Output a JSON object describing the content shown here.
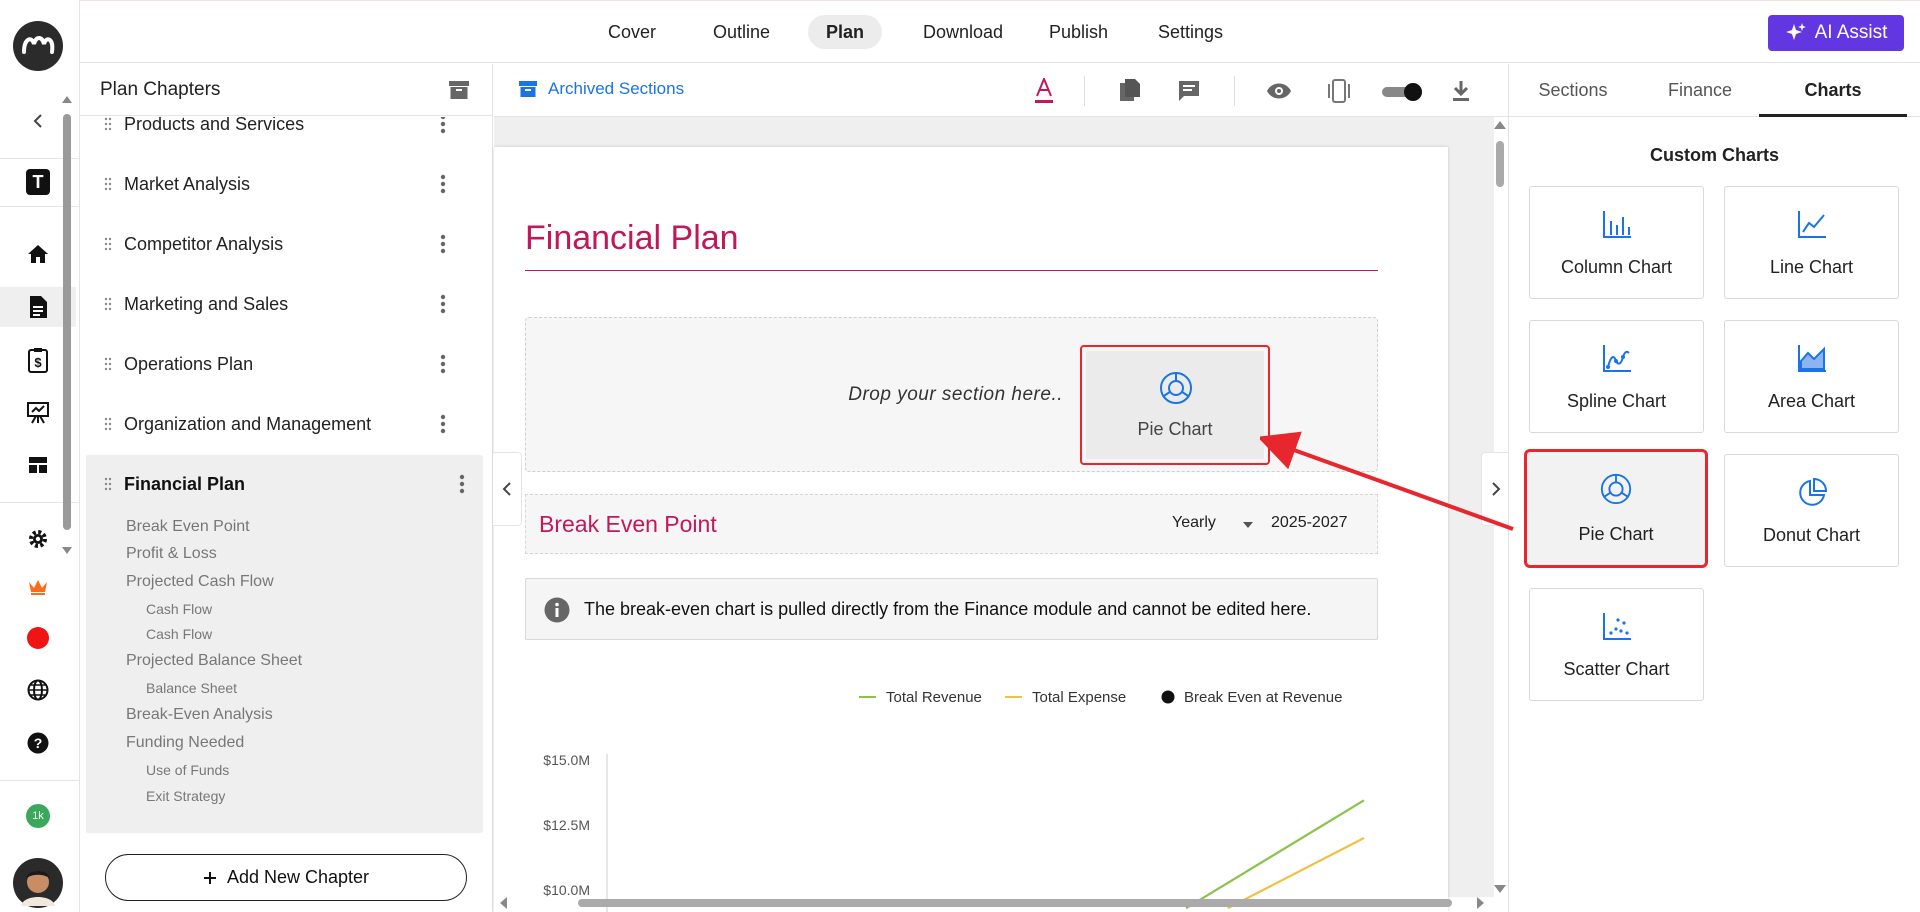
{
  "nav": {
    "tabs": [
      "Cover",
      "Outline",
      "Plan",
      "Download",
      "Publish",
      "Settings"
    ],
    "active_tab": "Plan",
    "ai_button": "AI Assist"
  },
  "rail": {
    "logo_icon": "brand-logo-icon",
    "collapse_icon": "chevron-left-icon",
    "template_letter": "T",
    "icons": [
      "home-icon",
      "document-icon",
      "invoice-icon",
      "presentation-icon",
      "dashboard-icon",
      "settings-icon",
      "crown-icon",
      "record-icon",
      "globe-icon",
      "help-icon"
    ],
    "badge": "1k"
  },
  "chapters": {
    "title": "Plan Chapters",
    "items": [
      "Products and Services",
      "Market Analysis",
      "Competitor Analysis",
      "Marketing and Sales",
      "Operations Plan",
      "Organization and Management",
      "Financial Plan"
    ],
    "active": "Financial Plan",
    "subsections": [
      {
        "label": "Break Even Point",
        "children": []
      },
      {
        "label": "Profit & Loss",
        "children": []
      },
      {
        "label": "Projected Cash Flow",
        "children": [
          "Cash Flow",
          "Cash Flow"
        ]
      },
      {
        "label": "Projected Balance Sheet",
        "children": [
          "Balance Sheet"
        ]
      },
      {
        "label": "Break-Even Analysis",
        "children": []
      },
      {
        "label": "Funding Needed",
        "children": [
          "Use of Funds",
          "Exit Strategy"
        ]
      }
    ],
    "add_button": "Add New Chapter"
  },
  "toolbar": {
    "archived": "Archived Sections",
    "icons": [
      "text-color-icon",
      "copy-page-icon",
      "comment-icon",
      "preview-eye-icon",
      "device-icon",
      "toggle-switch",
      "download-icon"
    ]
  },
  "document": {
    "title": "Financial Plan",
    "drop_text": "Drop your section here..",
    "drag_card_label": "Pie Chart",
    "section": {
      "title": "Break Even Point",
      "period": "Yearly",
      "range": "2025-2027"
    },
    "info": "The break-even chart is pulled directly from the Finance module and cannot be edited here.",
    "accent": "#c2185b"
  },
  "chart_data": {
    "type": "line",
    "ylim": [
      10000000,
      15000000
    ],
    "yticks": [
      "$15.0M",
      "$12.5M",
      "$10.0M"
    ],
    "series": [
      {
        "name": "Total Revenue",
        "color": "#8bc34a",
        "x": [
          0.765,
          1.0
        ],
        "y": [
          9300000,
          13450000
        ]
      },
      {
        "name": "Total Expense",
        "color": "#f0c040",
        "x": [
          0.82,
          1.0
        ],
        "y": [
          9300000,
          12000000
        ]
      }
    ],
    "markers": [
      {
        "name": "Break Even at Revenue",
        "color": "#111111"
      }
    ],
    "legend": "top-right"
  },
  "right_panel": {
    "tabs": [
      "Sections",
      "Finance",
      "Charts"
    ],
    "active_tab": "Charts",
    "heading": "Custom Charts",
    "charts": [
      "Column Chart",
      "Line Chart",
      "Spline Chart",
      "Area Chart",
      "Pie Chart",
      "Donut Chart",
      "Scatter Chart"
    ],
    "selected": "Pie Chart",
    "highlight_color": "#e8262d"
  }
}
